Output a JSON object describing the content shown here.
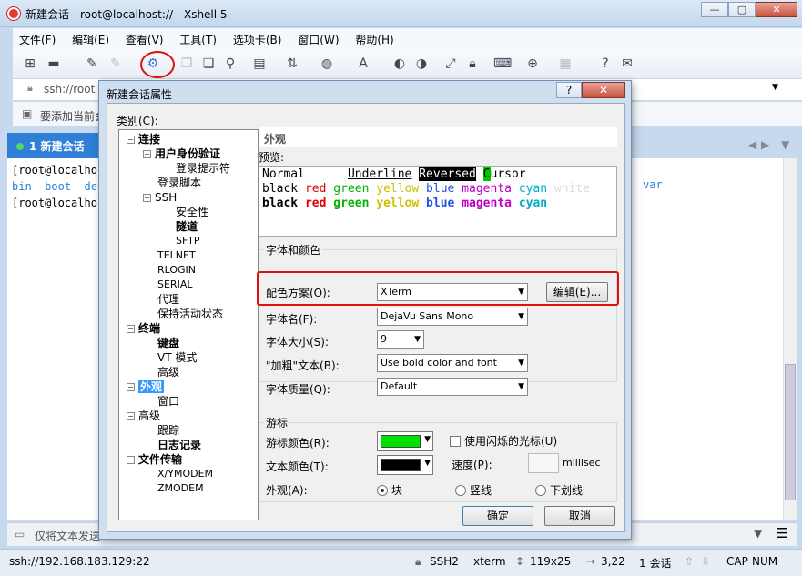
{
  "window": {
    "title": "新建会话 - root@localhost:// - Xshell 5",
    "minimize": "—",
    "maximize": "▢",
    "close": "✕"
  },
  "menu": [
    "文件(F)",
    "编辑(E)",
    "查看(V)",
    "工具(T)",
    "选项卡(B)",
    "窗口(W)",
    "帮助(H)"
  ],
  "addressbar": {
    "text": "ssh://root"
  },
  "hintbar": {
    "text": "要添加当前会"
  },
  "tab": {
    "label": "1 新建会话"
  },
  "terminal": {
    "line1": "[root@localhost",
    "line2_items": [
      "bin",
      "boot",
      "dev"
    ],
    "line2_tail": "var",
    "line3": "[root@localhost"
  },
  "sendbar": {
    "text": "仅将文本发送"
  },
  "status": {
    "address": "ssh://192.168.183.129:22",
    "protocol": "SSH2",
    "term": "xterm",
    "size": "119x25",
    "pos": "3,22",
    "sessions": "1 会话",
    "cap": "CAP",
    "num": "NUM"
  },
  "dialog": {
    "title": "新建会话属性",
    "help": "?",
    "close": "✕",
    "category_label": "类别(C):",
    "tree": {
      "connection": "连接",
      "auth": "用户身份验证",
      "login_prompt": "登录提示符",
      "login_script": "登录脚本",
      "ssh": "SSH",
      "security": "安全性",
      "tunnel": "隧道",
      "sftp": "SFTP",
      "telnet": "TELNET",
      "rlogin": "RLOGIN",
      "serial": "SERIAL",
      "proxy": "代理",
      "keepalive": "保持活动状态",
      "terminal": "终端",
      "keyboard": "键盘",
      "vt_mode": "VT 模式",
      "advanced1": "高级",
      "appearance": "外观",
      "window": "窗口",
      "advanced2": "高级",
      "trace": "跟踪",
      "logging": "日志记录",
      "file_transfer": "文件传输",
      "xymodem": "X/YMODEM",
      "zmodem": "ZMODEM"
    },
    "section_header": "外观",
    "preview_label": "预览:",
    "preview": {
      "normal": "Normal",
      "underline": "Underline",
      "reversed": "Reversed",
      "cursor_c": "C",
      "cursor_rest": "ursor",
      "colors": [
        "black",
        "red",
        "green",
        "yellow",
        "blue",
        "magenta",
        "cyan",
        "white"
      ]
    },
    "font_group": {
      "title": "字体和颜色",
      "scheme_label": "配色方案(O):",
      "scheme_value": "XTerm",
      "edit_button": "编辑(E)...",
      "font_label": "字体名(F):",
      "font_value": "DejaVu Sans Mono",
      "size_label": "字体大小(S):",
      "size_value": "9",
      "bold_label": "\"加粗\"文本(B):",
      "bold_value": "Use bold color and font",
      "quality_label": "字体质量(Q):",
      "quality_value": "Default"
    },
    "cursor_group": {
      "title": "游标",
      "cursor_color_label": "游标颜色(R):",
      "cursor_color": "#00e000",
      "blink_label": "使用闪烁的光标(U)",
      "text_color_label": "文本颜色(T):",
      "text_color": "#000000",
      "speed_label": "速度(P):",
      "speed_value": "",
      "speed_unit": "millisec",
      "shape_label": "外观(A):",
      "shape_block": "块",
      "shape_vline": "竖线",
      "shape_underline": "下划线"
    },
    "ok": "确定",
    "cancel": "取消"
  }
}
